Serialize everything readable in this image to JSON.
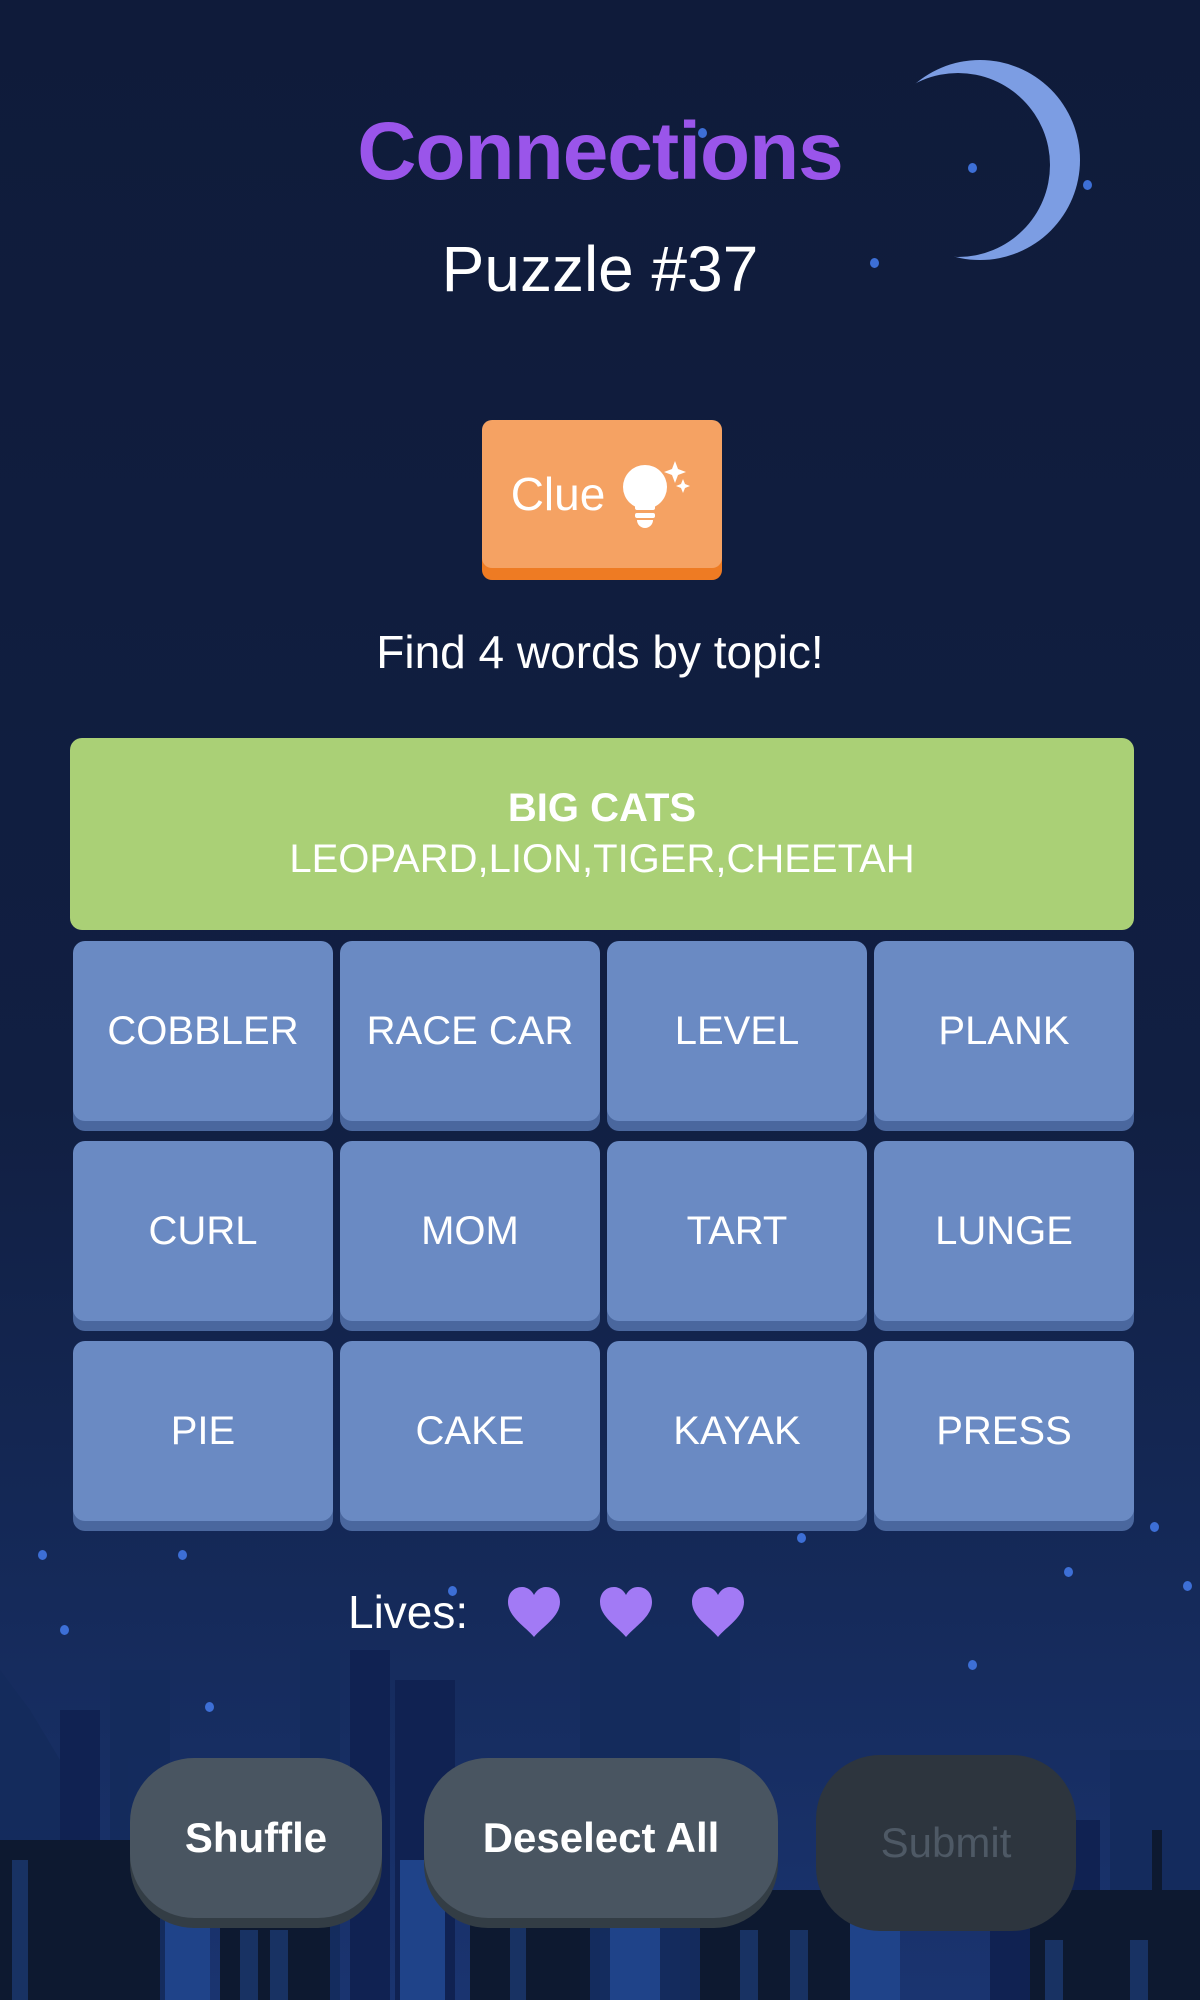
{
  "header": {
    "title": "Connections",
    "puzzle_label": "Puzzle #37"
  },
  "clue_button": {
    "label": "Clue",
    "icon": "lightbulb-sparkle-icon"
  },
  "instructions": "Find 4 words by topic!",
  "solved_groups": [
    {
      "category": "BIG CATS",
      "words": "LEOPARD,LION,TIGER,CHEETAH",
      "color": "#aad076"
    }
  ],
  "tiles": [
    "COBBLER",
    "RACE CAR",
    "LEVEL",
    "PLANK",
    "CURL",
    "MOM",
    "TART",
    "LUNGE",
    "PIE",
    "CAKE",
    "KAYAK",
    "PRESS"
  ],
  "lives": {
    "label": "Lives:",
    "remaining": 3,
    "heart_color": "#a27af5"
  },
  "actions": {
    "shuffle": "Shuffle",
    "deselect_all": "Deselect All",
    "submit": "Submit",
    "submit_enabled": false
  },
  "colors": {
    "title": "#9a55ea",
    "tile": "#6a8ac3",
    "clue": "#f5a263",
    "background": "#0f1b3a"
  }
}
